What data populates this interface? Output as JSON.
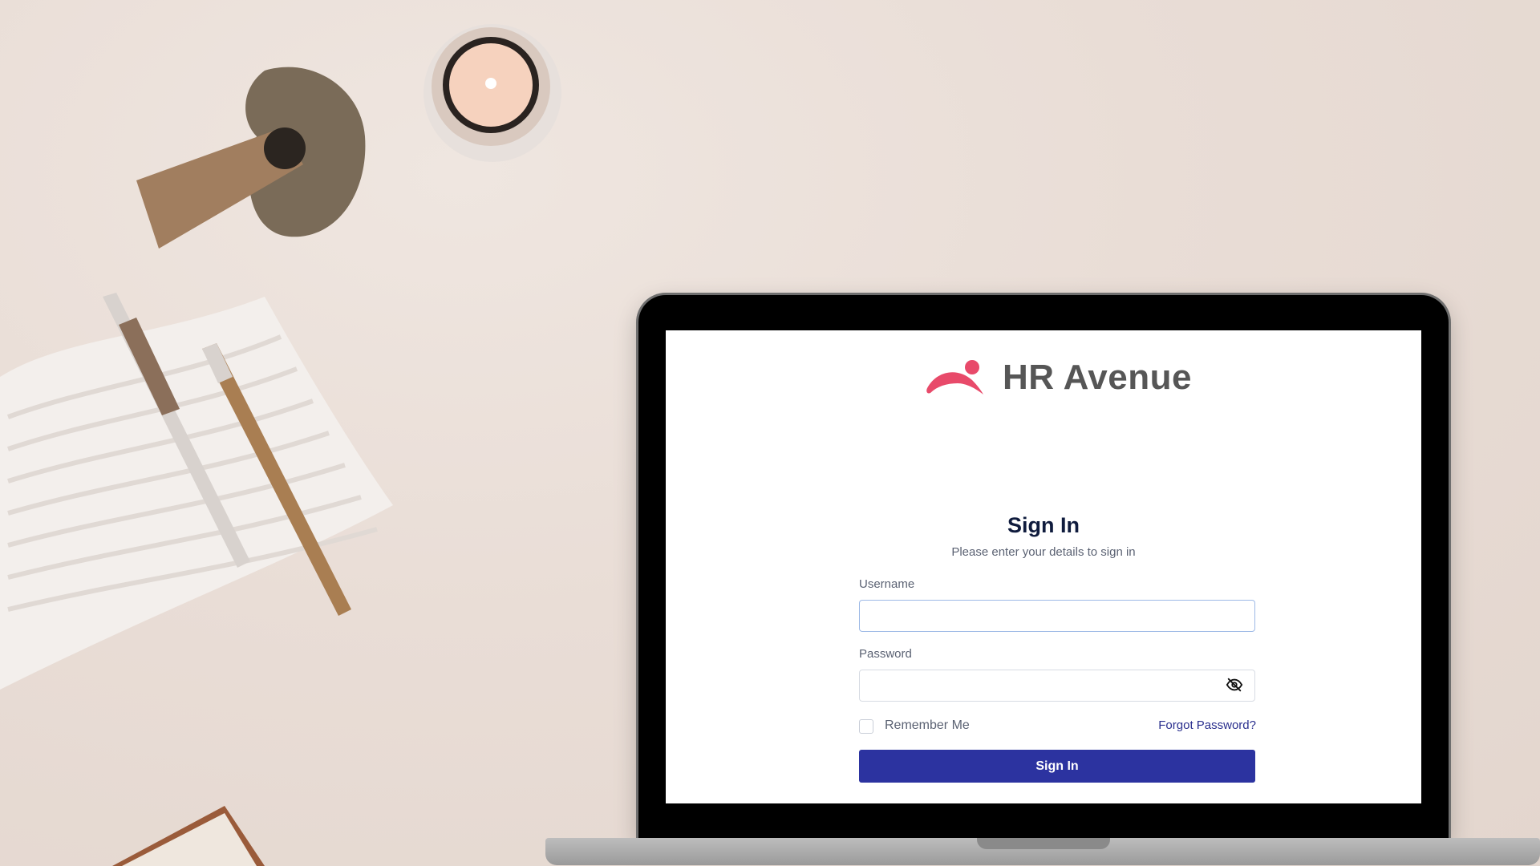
{
  "app": {
    "brand_name": "HR Avenue",
    "brand_color": "#e84a6a",
    "accent_color": "#2c33a0"
  },
  "signin": {
    "title": "Sign In",
    "subtitle": "Please enter your details to sign in",
    "username_label": "Username",
    "username_value": "",
    "password_label": "Password",
    "password_value": "",
    "password_toggle_icon": "eye-off-icon",
    "remember_label": "Remember Me",
    "remember_checked": false,
    "forgot_label": "Forgot Password?",
    "button_label": "Sign In"
  }
}
